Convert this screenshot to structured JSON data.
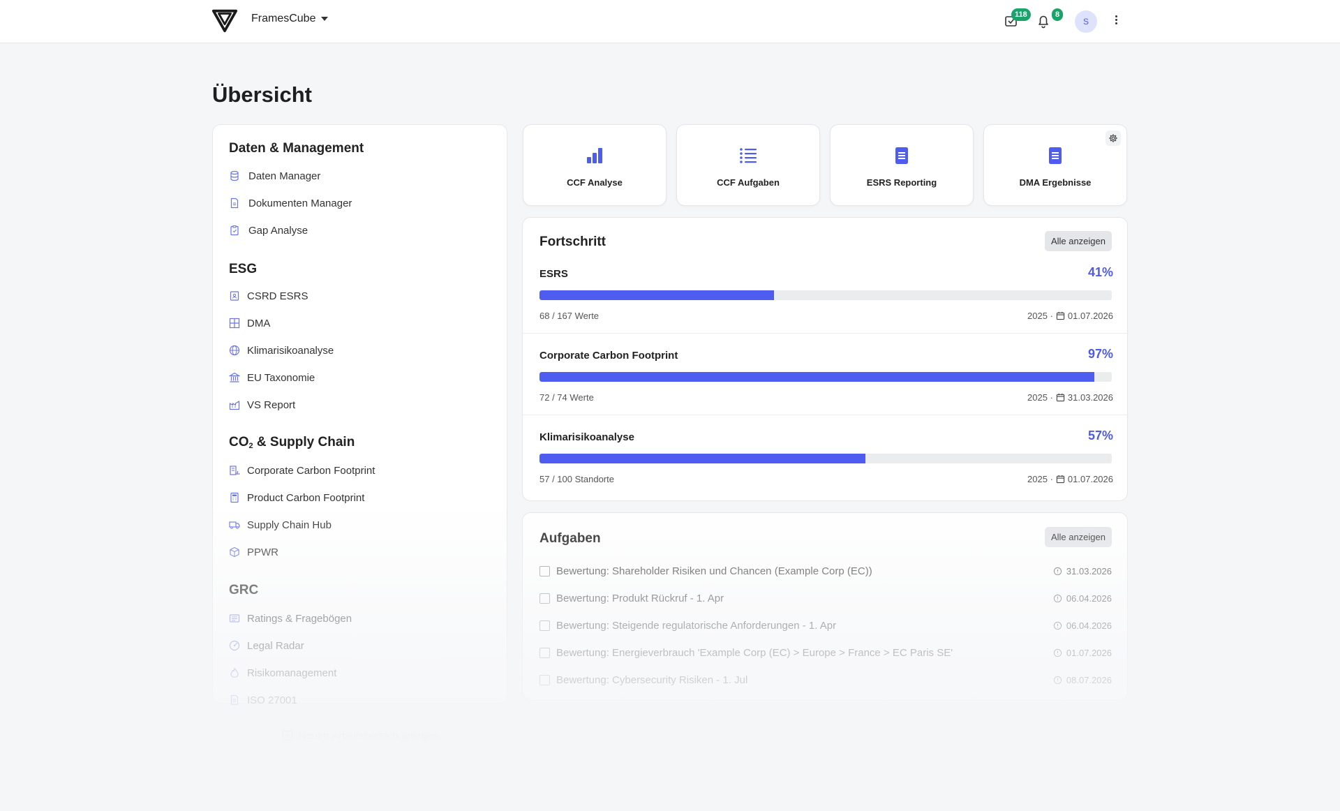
{
  "app": {
    "brand": "FramesCube",
    "tasks_badge": "118",
    "notifications_badge": "8",
    "avatar_initial": "S"
  },
  "page": {
    "title": "Übersicht"
  },
  "sidebar": {
    "sections": [
      {
        "title": "Daten & Management",
        "items": [
          "Daten Manager",
          "Dokumenten Manager",
          "Gap Analyse"
        ]
      },
      {
        "title": "ESG",
        "items": [
          "CSRD ESRS",
          "DMA",
          "Klimarisikoanalyse",
          "EU Taxonomie",
          "VS Report"
        ]
      },
      {
        "title_prefix": "CO",
        "title_sub": "2",
        "title_suffix": " & Supply Chain",
        "items": [
          "Corporate Carbon Footprint",
          "Product Carbon Footprint",
          "Supply Chain Hub",
          "PPWR"
        ]
      },
      {
        "title": "GRC",
        "items": [
          "Ratings & Fragebögen",
          "Legal Radar",
          "Risikomanagement",
          "ISO 27001"
        ]
      }
    ],
    "new_area_label": "Neuen Arbeitsbereich anlegen"
  },
  "tiles": [
    "CCF Analyse",
    "CCF Aufgaben",
    "ESRS Reporting",
    "DMA Ergebnisse"
  ],
  "progress": {
    "title": "Fortschritt",
    "show_all": "Alle anzeigen",
    "rows": [
      {
        "name": "ESRS",
        "percent_label": "41%",
        "fraction": 0.41,
        "meta": "68 / 167 Werte",
        "year": "2025 ·",
        "date": "01.07.2026"
      },
      {
        "name": "Corporate Carbon Footprint",
        "percent_label": "97%",
        "fraction": 0.97,
        "meta": "72 / 74 Werte",
        "year": "2025 ·",
        "date": "31.03.2026"
      },
      {
        "name": "Klimarisikoanalyse",
        "percent_label": "57%",
        "fraction": 0.57,
        "meta": "57 / 100 Standorte",
        "year": "2025 ·",
        "date": "01.07.2026"
      }
    ]
  },
  "tasks": {
    "title": "Aufgaben",
    "show_all": "Alle anzeigen",
    "items": [
      {
        "label": "Bewertung: Shareholder Risiken und Chancen (Example Corp (EC))",
        "date": "31.03.2026"
      },
      {
        "label": "Bewertung: Produkt Rückruf - 1. Apr",
        "date": "06.04.2026"
      },
      {
        "label": "Bewertung: Steigende regulatorische Anforderungen - 1. Apr",
        "date": "06.04.2026"
      },
      {
        "label": "Bewertung: Energieverbrauch 'Example Corp (EC) > Europe > France > EC Paris SE'",
        "date": "01.07.2026"
      },
      {
        "label": "Bewertung: Cybersecurity Risiken - 1. Jul",
        "date": "08.07.2026"
      }
    ]
  },
  "colors": {
    "accent": "#4e5cf0",
    "badge": "#1aa36a",
    "track": "#ebecee"
  }
}
